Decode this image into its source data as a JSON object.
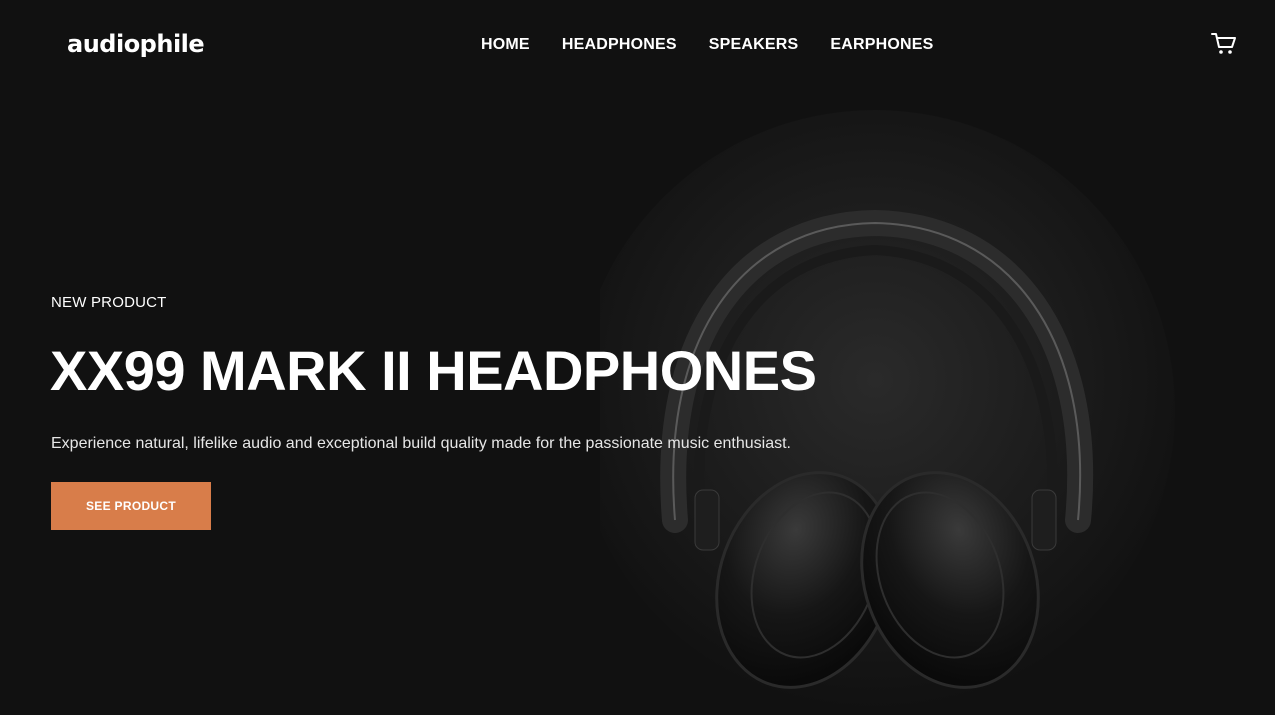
{
  "brand": {
    "logo": "audiophile"
  },
  "nav": {
    "items": [
      {
        "label": "HOME"
      },
      {
        "label": "HEADPHONES"
      },
      {
        "label": "SPEAKERS"
      },
      {
        "label": "EARPHONES"
      }
    ]
  },
  "icons": {
    "cart": "cart-icon"
  },
  "hero": {
    "overline": "NEW PRODUCT",
    "title": "XX99 MARK II HEADPHONES",
    "description": "Experience natural, lifelike audio and exceptional build quality made for the passionate music enthusiast.",
    "cta_label": "SEE PRODUCT"
  },
  "colors": {
    "background": "#111111",
    "accent": "#D87D4A",
    "text": "#FFFFFF"
  }
}
